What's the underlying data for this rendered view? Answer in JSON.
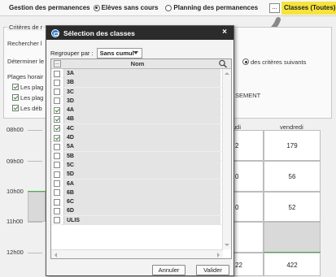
{
  "topbar": {
    "title": "Gestion des permanences",
    "options": [
      {
        "label": "Elèves sans cours",
        "selected": true
      },
      {
        "label": "Planning des permanences",
        "selected": false
      }
    ],
    "more_label": "...",
    "classes_label": "Classes (Toutes)"
  },
  "criteria": {
    "legend": "Critères de r",
    "lines": [
      "Rechercher l",
      "Déterminer le",
      "Plages horair"
    ],
    "checks": [
      {
        "label": "Les plag",
        "checked": true
      },
      {
        "label": "Les plag",
        "checked": true
      },
      {
        "label": "Les déb",
        "checked": true
      }
    ],
    "right_option": "des critères suivants",
    "right_text": "SEMENT"
  },
  "schedule": {
    "hours": [
      "08h00",
      "09h00",
      "10h00",
      "11h00",
      "12h00"
    ],
    "col_headers": [
      "udi",
      "vendredi"
    ],
    "col_a": [
      "2",
      "0",
      "0",
      "",
      "22"
    ],
    "col_b": [
      "179",
      "56",
      "52",
      "",
      "422"
    ]
  },
  "dialog": {
    "title": "Sélection des classes",
    "close": "×",
    "group_label": "Regrouper par :",
    "group_value": "Sans cumul",
    "column_header": "Nom",
    "items": [
      {
        "name": "3A",
        "checked": false
      },
      {
        "name": "3B",
        "checked": false
      },
      {
        "name": "3C",
        "checked": false
      },
      {
        "name": "3D",
        "checked": false
      },
      {
        "name": "4A",
        "checked": true
      },
      {
        "name": "4B",
        "checked": true
      },
      {
        "name": "4C",
        "checked": true
      },
      {
        "name": "4D",
        "checked": true
      },
      {
        "name": "5A",
        "checked": false
      },
      {
        "name": "5B",
        "checked": false
      },
      {
        "name": "5C",
        "checked": false
      },
      {
        "name": "5D",
        "checked": false
      },
      {
        "name": "6A",
        "checked": false
      },
      {
        "name": "6B",
        "checked": false
      },
      {
        "name": "6C",
        "checked": false
      },
      {
        "name": "6D",
        "checked": false
      },
      {
        "name": "ULIS",
        "checked": false
      }
    ],
    "cancel_label": "Annuler",
    "ok_label": "Valider"
  },
  "colors": {
    "highlight": "#f6e33c",
    "header_bg": "#2b2b2b",
    "check_green": "#2a8a2a"
  }
}
